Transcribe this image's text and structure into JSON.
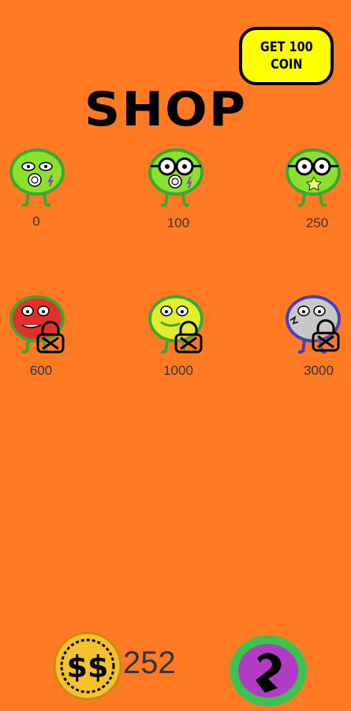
{
  "header": {
    "get_coin_label": "GET 100\nCOIN",
    "title": "SHOP"
  },
  "characters": [
    {
      "price": "0",
      "body_color": "#8be12b",
      "eyes": "plain",
      "locked": false
    },
    {
      "price": "100",
      "body_color": "#8be12b",
      "eyes": "glasses",
      "locked": false
    },
    {
      "price": "250",
      "body_color": "#8be12b",
      "eyes": "glasses",
      "locked": false
    },
    {
      "price": "600",
      "body_color": "#e3302b",
      "eyes": "plain",
      "locked": true
    },
    {
      "price": "1000",
      "body_color": "#e2ee2a",
      "eyes": "plain",
      "locked": true
    },
    {
      "price": "3000",
      "body_color": "#c8c8c8",
      "eyes": "plain",
      "locked": true
    }
  ],
  "footer": {
    "coin_count": "252",
    "coin_icon": "dollar-coin-icon",
    "back_icon": "back-arrow-icon"
  },
  "colors": {
    "background": "#ff7a22",
    "get_coin_bg": "#ffff00",
    "back_ring": "#3ec24f",
    "back_inner": "#b23bc4"
  }
}
